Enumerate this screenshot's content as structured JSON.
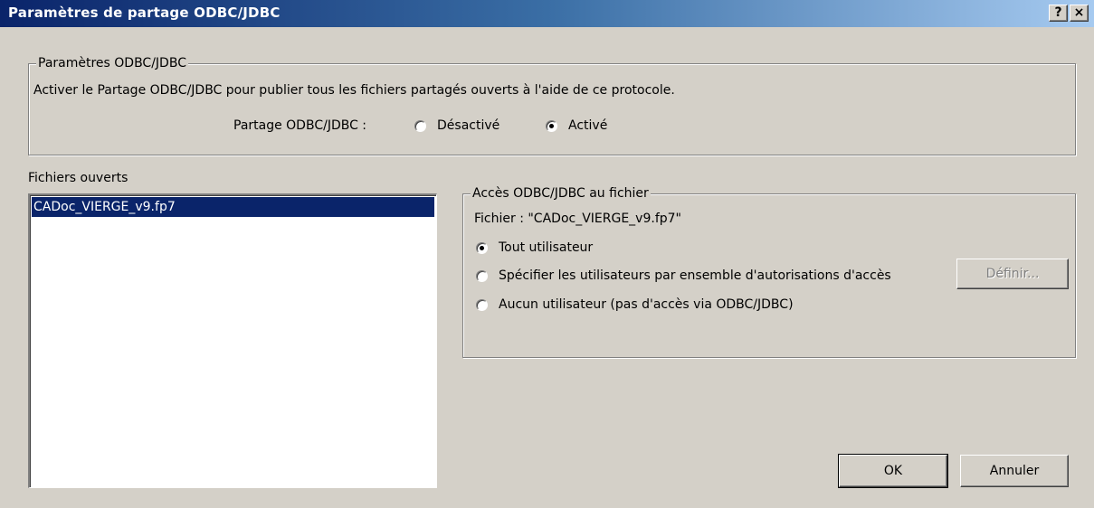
{
  "window": {
    "title": "Paramètres de partage ODBC/JDBC",
    "help_button": "?",
    "close_button": "×"
  },
  "odbc_group": {
    "label": "Paramètres ODBC/JDBC",
    "description": "Activer le Partage ODBC/JDBC pour publier tous les fichiers partagés ouverts à l'aide de ce protocole.",
    "sharing_label": "Partage ODBC/JDBC :",
    "options": [
      {
        "label": "Désactivé",
        "checked": false
      },
      {
        "label": "Activé",
        "checked": true
      }
    ]
  },
  "open_files": {
    "label": "Fichiers ouverts",
    "items": [
      {
        "name": "CADoc_VIERGE_v9.fp7",
        "selected": true
      }
    ]
  },
  "file_access": {
    "label": "Accès ODBC/JDBC au fichier",
    "file_line": "Fichier : \"CADoc_VIERGE_v9.fp7\"",
    "options": [
      {
        "label": "Tout utilisateur",
        "checked": true
      },
      {
        "label": "Spécifier les utilisateurs par ensemble d'autorisations d'accès",
        "checked": false
      },
      {
        "label": "Aucun utilisateur (pas d'accès via ODBC/JDBC)",
        "checked": false
      }
    ],
    "define_button": "Définir..."
  },
  "buttons": {
    "ok": "OK",
    "cancel": "Annuler"
  }
}
